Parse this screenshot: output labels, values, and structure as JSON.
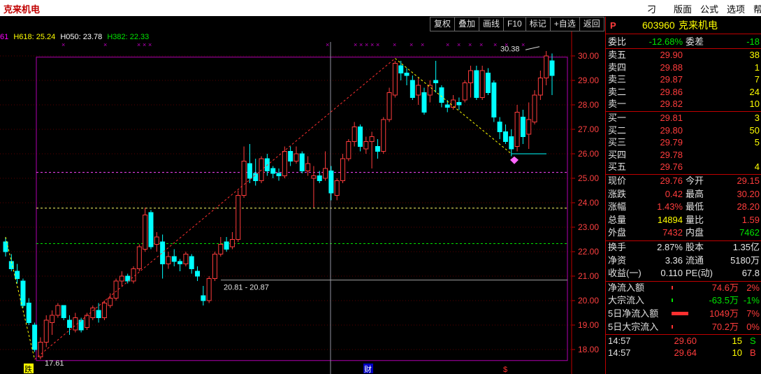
{
  "app": {
    "title": "克来机电"
  },
  "menu": [
    {
      "label": "刁",
      "x": 0
    },
    {
      "label": "版面"
    },
    {
      "label": "公式"
    },
    {
      "label": "选项"
    },
    {
      "label": "帮"
    }
  ],
  "toolbar": [
    "复权",
    "叠加",
    "画线",
    "F10",
    "标记",
    "+自选",
    "返回"
  ],
  "ma_line": {
    "prefix": "61",
    "h618": "H618: 25.24",
    "h050": "H050: 23.78",
    "h382": "H382: 22.33"
  },
  "colors": {
    "up": "#ff3c3c",
    "down": "#00ffff",
    "accent": "#c00000",
    "fib": "#ff00ff"
  },
  "chart_data": {
    "type": "candlestick",
    "ylim": [
      17.3,
      30.7
    ],
    "y_ticks": [
      18.0,
      19.0,
      20.0,
      21.0,
      22.0,
      23.0,
      24.0,
      25.0,
      26.0,
      27.0,
      28.0,
      29.0,
      30.0
    ],
    "y_tick_labels": [
      "18.00",
      "19.00",
      "20.00",
      "21.00",
      "22.00",
      "23.00",
      "24.00",
      "25.00",
      "26.00",
      "27.00",
      "28.00",
      "29.00",
      "30.00"
    ],
    "fib_lines": [
      25.24,
      23.78,
      22.33
    ],
    "candles": [
      {
        "o": 22.4,
        "h": 22.6,
        "l": 21.8,
        "c": 22.0
      },
      {
        "o": 21.6,
        "h": 21.9,
        "l": 21.2,
        "c": 21.3
      },
      {
        "o": 21.2,
        "h": 21.5,
        "l": 20.7,
        "c": 20.9
      },
      {
        "o": 20.8,
        "h": 20.9,
        "l": 19.7,
        "c": 19.8
      },
      {
        "o": 19.9,
        "h": 20.1,
        "l": 19.0,
        "c": 19.1
      },
      {
        "o": 19.0,
        "h": 19.1,
        "l": 17.9,
        "c": 18.0
      },
      {
        "o": 17.7,
        "h": 18.5,
        "l": 17.6,
        "c": 18.3
      },
      {
        "o": 18.3,
        "h": 19.4,
        "l": 18.1,
        "c": 19.2
      },
      {
        "o": 19.1,
        "h": 19.6,
        "l": 18.6,
        "c": 19.4
      },
      {
        "o": 19.4,
        "h": 19.9,
        "l": 19.3,
        "c": 19.8
      },
      {
        "o": 19.8,
        "h": 19.8,
        "l": 19.2,
        "c": 19.3
      },
      {
        "o": 19.2,
        "h": 19.4,
        "l": 18.6,
        "c": 18.9
      },
      {
        "o": 18.8,
        "h": 19.5,
        "l": 18.7,
        "c": 19.3
      },
      {
        "o": 19.2,
        "h": 19.3,
        "l": 18.7,
        "c": 18.8
      },
      {
        "o": 18.9,
        "h": 19.5,
        "l": 18.8,
        "c": 19.4
      },
      {
        "o": 19.3,
        "h": 19.8,
        "l": 19.2,
        "c": 19.7
      },
      {
        "o": 19.6,
        "h": 19.9,
        "l": 19.1,
        "c": 19.3
      },
      {
        "o": 19.3,
        "h": 20.0,
        "l": 19.2,
        "c": 19.9
      },
      {
        "o": 19.8,
        "h": 20.3,
        "l": 19.7,
        "c": 20.1
      },
      {
        "o": 20.1,
        "h": 20.9,
        "l": 20.0,
        "c": 20.8
      },
      {
        "o": 20.8,
        "h": 21.2,
        "l": 20.6,
        "c": 21.0
      },
      {
        "o": 21.0,
        "h": 21.1,
        "l": 20.7,
        "c": 20.8
      },
      {
        "o": 20.8,
        "h": 21.4,
        "l": 20.7,
        "c": 21.3
      },
      {
        "o": 21.3,
        "h": 22.3,
        "l": 21.2,
        "c": 22.2
      },
      {
        "o": 22.1,
        "h": 23.8,
        "l": 22.0,
        "c": 23.5
      },
      {
        "o": 23.6,
        "h": 23.7,
        "l": 22.1,
        "c": 22.2
      },
      {
        "o": 22.3,
        "h": 22.8,
        "l": 22.0,
        "c": 22.6
      },
      {
        "o": 22.4,
        "h": 22.7,
        "l": 20.9,
        "c": 21.5
      },
      {
        "o": 21.5,
        "h": 22.0,
        "l": 21.3,
        "c": 21.8
      },
      {
        "o": 21.8,
        "h": 22.1,
        "l": 21.4,
        "c": 21.6
      },
      {
        "o": 21.6,
        "h": 21.7,
        "l": 21.2,
        "c": 21.5
      },
      {
        "o": 21.5,
        "h": 22.0,
        "l": 21.4,
        "c": 21.9
      },
      {
        "o": 21.8,
        "h": 21.9,
        "l": 21.1,
        "c": 21.3
      },
      {
        "o": 21.2,
        "h": 21.4,
        "l": 20.8,
        "c": 21.0
      },
      {
        "o": 20.2,
        "h": 20.6,
        "l": 19.8,
        "c": 20.0
      },
      {
        "o": 20.0,
        "h": 21.0,
        "l": 19.9,
        "c": 20.9
      },
      {
        "o": 20.9,
        "h": 22.0,
        "l": 20.8,
        "c": 21.9
      },
      {
        "o": 21.9,
        "h": 22.6,
        "l": 21.8,
        "c": 22.3
      },
      {
        "o": 22.4,
        "h": 22.6,
        "l": 22.0,
        "c": 22.1
      },
      {
        "o": 22.2,
        "h": 22.8,
        "l": 22.1,
        "c": 22.5
      },
      {
        "o": 22.5,
        "h": 24.5,
        "l": 22.4,
        "c": 24.3
      },
      {
        "o": 24.3,
        "h": 26.3,
        "l": 24.2,
        "c": 25.7
      },
      {
        "o": 25.6,
        "h": 26.4,
        "l": 24.8,
        "c": 25.0
      },
      {
        "o": 25.2,
        "h": 25.8,
        "l": 24.7,
        "c": 24.9
      },
      {
        "o": 24.9,
        "h": 25.9,
        "l": 24.8,
        "c": 25.8
      },
      {
        "o": 25.8,
        "h": 26.0,
        "l": 25.1,
        "c": 25.3
      },
      {
        "o": 25.4,
        "h": 25.5,
        "l": 25.0,
        "c": 25.2
      },
      {
        "o": 25.2,
        "h": 25.4,
        "l": 24.9,
        "c": 25.1
      },
      {
        "o": 25.1,
        "h": 26.3,
        "l": 25.0,
        "c": 26.1
      },
      {
        "o": 26.1,
        "h": 26.3,
        "l": 25.5,
        "c": 25.7
      },
      {
        "o": 25.7,
        "h": 26.3,
        "l": 25.6,
        "c": 26.0
      },
      {
        "o": 26.0,
        "h": 26.1,
        "l": 25.2,
        "c": 25.3
      },
      {
        "o": 25.3,
        "h": 25.9,
        "l": 25.1,
        "c": 25.6
      },
      {
        "o": 25.0,
        "h": 25.5,
        "l": 23.8,
        "c": 25.1
      },
      {
        "o": 25.1,
        "h": 25.3,
        "l": 24.8,
        "c": 24.9
      },
      {
        "o": 25.0,
        "h": 26.1,
        "l": 24.9,
        "c": 25.4
      },
      {
        "o": 25.3,
        "h": 25.5,
        "l": 24.1,
        "c": 24.4
      },
      {
        "o": 24.3,
        "h": 25.0,
        "l": 24.1,
        "c": 24.9
      },
      {
        "o": 24.9,
        "h": 26.0,
        "l": 24.8,
        "c": 25.8
      },
      {
        "o": 25.8,
        "h": 26.6,
        "l": 25.7,
        "c": 26.5
      },
      {
        "o": 26.5,
        "h": 27.3,
        "l": 26.3,
        "c": 27.1
      },
      {
        "o": 27.1,
        "h": 27.2,
        "l": 26.1,
        "c": 26.3
      },
      {
        "o": 26.2,
        "h": 26.7,
        "l": 26.0,
        "c": 26.5
      },
      {
        "o": 26.5,
        "h": 26.9,
        "l": 25.4,
        "c": 26.7
      },
      {
        "o": 26.3,
        "h": 26.6,
        "l": 25.8,
        "c": 26.1
      },
      {
        "o": 26.1,
        "h": 27.5,
        "l": 26.0,
        "c": 27.4
      },
      {
        "o": 27.4,
        "h": 28.7,
        "l": 27.3,
        "c": 28.5
      },
      {
        "o": 28.4,
        "h": 29.8,
        "l": 28.3,
        "c": 29.7
      },
      {
        "o": 29.6,
        "h": 29.8,
        "l": 29.0,
        "c": 29.3
      },
      {
        "o": 29.3,
        "h": 29.5,
        "l": 28.8,
        "c": 29.2
      },
      {
        "o": 29.0,
        "h": 29.2,
        "l": 28.2,
        "c": 28.3
      },
      {
        "o": 28.4,
        "h": 29.1,
        "l": 28.0,
        "c": 28.8
      },
      {
        "o": 28.5,
        "h": 28.7,
        "l": 27.6,
        "c": 27.7
      },
      {
        "o": 28.4,
        "h": 29.0,
        "l": 28.1,
        "c": 28.8
      },
      {
        "o": 29.0,
        "h": 29.8,
        "l": 28.5,
        "c": 28.9
      },
      {
        "o": 28.7,
        "h": 28.8,
        "l": 27.9,
        "c": 28.1
      },
      {
        "o": 28.0,
        "h": 28.2,
        "l": 27.7,
        "c": 27.9
      },
      {
        "o": 27.9,
        "h": 28.4,
        "l": 27.8,
        "c": 28.2
      },
      {
        "o": 28.1,
        "h": 28.3,
        "l": 27.8,
        "c": 28.0
      },
      {
        "o": 28.2,
        "h": 29.0,
        "l": 28.1,
        "c": 28.9
      },
      {
        "o": 28.9,
        "h": 29.6,
        "l": 28.3,
        "c": 29.4
      },
      {
        "o": 29.4,
        "h": 29.6,
        "l": 28.2,
        "c": 28.3
      },
      {
        "o": 28.3,
        "h": 29.6,
        "l": 28.2,
        "c": 29.4
      },
      {
        "o": 29.3,
        "h": 29.5,
        "l": 28.4,
        "c": 28.5
      },
      {
        "o": 28.9,
        "h": 29.0,
        "l": 27.3,
        "c": 27.5
      },
      {
        "o": 27.3,
        "h": 27.5,
        "l": 26.6,
        "c": 26.9
      },
      {
        "o": 26.9,
        "h": 27.2,
        "l": 26.4,
        "c": 26.5
      },
      {
        "o": 26.7,
        "h": 27.0,
        "l": 25.9,
        "c": 26.2
      },
      {
        "o": 26.3,
        "h": 28.0,
        "l": 26.1,
        "c": 27.7
      },
      {
        "o": 27.5,
        "h": 27.8,
        "l": 26.4,
        "c": 26.7
      },
      {
        "o": 26.8,
        "h": 28.1,
        "l": 26.2,
        "c": 27.4
      },
      {
        "o": 27.3,
        "h": 28.6,
        "l": 27.2,
        "c": 28.4
      },
      {
        "o": 28.4,
        "h": 29.4,
        "l": 28.2,
        "c": 29.1
      },
      {
        "o": 29.1,
        "h": 30.2,
        "l": 28.8,
        "c": 30.0
      },
      {
        "o": 29.8,
        "h": 30.1,
        "l": 28.4,
        "c": 29.2
      }
    ],
    "annotations": {
      "high_label": "30.38",
      "low_label": "17.61",
      "gap_label": "20.81 - 20.87",
      "bottom_marks": [
        "跌",
        "财",
        "$"
      ]
    }
  },
  "quote": {
    "code_prefix": "P",
    "code": "603960",
    "name": "克来机电",
    "weibi_label": "委比",
    "weibi": "-12.68%",
    "weicha_label": "委差",
    "weicha": "-18",
    "sells": [
      {
        "label": "卖五",
        "price": "29.90",
        "vol": "38"
      },
      {
        "label": "卖四",
        "price": "29.88",
        "vol": "1"
      },
      {
        "label": "卖三",
        "price": "29.87",
        "vol": "7"
      },
      {
        "label": "卖二",
        "price": "29.86",
        "vol": "24"
      },
      {
        "label": "卖一",
        "price": "29.82",
        "vol": "10"
      }
    ],
    "buys": [
      {
        "label": "买一",
        "price": "29.81",
        "vol": "3"
      },
      {
        "label": "买二",
        "price": "29.80",
        "vol": "50"
      },
      {
        "label": "买三",
        "price": "29.79",
        "vol": "5"
      },
      {
        "label": "买四",
        "price": "29.78",
        "vol": ""
      },
      {
        "label": "买五",
        "price": "29.76",
        "vol": "4"
      }
    ],
    "stats": [
      {
        "l1": "现价",
        "v1": "29.76",
        "c1": "red",
        "l2": "今开",
        "v2": "29.15",
        "c2": "red"
      },
      {
        "l1": "涨跌",
        "v1": "0.42",
        "c1": "red",
        "l2": "最高",
        "v2": "30.20",
        "c2": "red"
      },
      {
        "l1": "涨幅",
        "v1": "1.43%",
        "c1": "red",
        "l2": "最低",
        "v2": "28.20",
        "c2": "red"
      },
      {
        "l1": "总量",
        "v1": "14894",
        "c1": "yel",
        "l2": "量比",
        "v2": "1.59",
        "c2": "red"
      },
      {
        "l1": "外盘",
        "v1": "7432",
        "c1": "red",
        "l2": "内盘",
        "v2": "7462",
        "c2": "grn"
      }
    ],
    "stats2": [
      {
        "l1": "换手",
        "v1": "2.87%",
        "l2": "股本",
        "v2": "1.35亿"
      },
      {
        "l1": "净资",
        "v1": "3.36",
        "l2": "流通",
        "v2": "5180万"
      },
      {
        "l1": "收益(一)",
        "v1": "0.110",
        "l2": "PE(动)",
        "v2": "67.8"
      }
    ],
    "flows": [
      {
        "label": "净流入额",
        "val": "74.6万",
        "pct": "2%",
        "c": "red",
        "bar": 2
      },
      {
        "label": "大宗流入",
        "val": "-63.5万",
        "pct": "-1%",
        "c": "grn",
        "bar": 2
      },
      {
        "label": "5日净流入额",
        "val": "1049万",
        "pct": "7%",
        "c": "red",
        "bar": 24
      },
      {
        "label": "5日大宗流入",
        "val": "70.2万",
        "pct": "0%",
        "c": "red",
        "bar": 2
      }
    ],
    "ticks": [
      {
        "time": "14:57",
        "price": "29.60",
        "vol": "15",
        "flag": "S"
      },
      {
        "time": "14:57",
        "price": "29.64",
        "vol": "10",
        "flag": "B"
      }
    ]
  }
}
